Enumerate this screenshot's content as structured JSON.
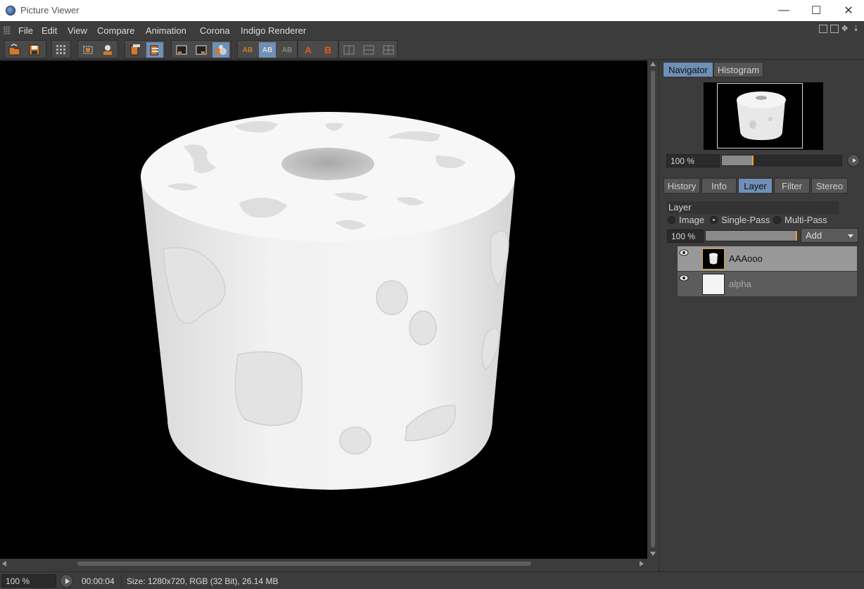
{
  "window": {
    "title": "Picture Viewer",
    "minimize": "—",
    "maximize": "☐",
    "close": "✕"
  },
  "menu": [
    "File",
    "Edit",
    "View",
    "Compare",
    "Animation",
    "Corona",
    "Indigo Renderer"
  ],
  "toolbar": {
    "icons": [
      "open-icon",
      "save-icon",
      "grid-icon",
      "region-icon",
      "user-icon",
      "stack-left-icon",
      "stack-right-icon",
      "view-a-icon",
      "view-b-icon",
      "view-ab-icon",
      "ab-icon",
      "ab-split-icon",
      "ab-gray-icon",
      "set-a-icon",
      "set-b-icon",
      "layout-1-icon",
      "layout-2-icon",
      "layout-3-icon"
    ],
    "letters": {
      "a": "A",
      "b": "B",
      "ab": "AB"
    }
  },
  "navigator": {
    "tabs": [
      "Navigator",
      "Histogram"
    ],
    "active_tab": "Navigator",
    "zoom": "100 %",
    "zoom_fraction": 0.25
  },
  "panel_tabs": {
    "items": [
      "History",
      "Info",
      "Layer",
      "Filter",
      "Stereo"
    ],
    "active": "Layer"
  },
  "layer": {
    "section_label": "Layer",
    "modes": [
      "Image",
      "Single-Pass",
      "Multi-Pass"
    ],
    "selected_mode": "Single-Pass",
    "opacity": "100 %",
    "add_label": "Add",
    "layers": [
      {
        "name": "AAAooo",
        "selected": true
      },
      {
        "name": "alpha",
        "selected": false
      }
    ]
  },
  "status": {
    "zoom": "100 %",
    "time": "00:00:04",
    "info": "Size: 1280x720, RGB (32 Bit), 26.14 MB"
  },
  "colors": {
    "accent": "#6f8fb6",
    "panel": "#3c3c3c",
    "viewport": "#000000",
    "marker": "#f0a030"
  }
}
